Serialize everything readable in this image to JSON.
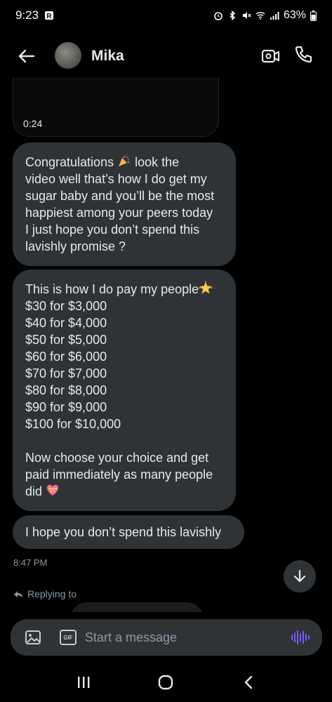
{
  "status_bar": {
    "time": "9:23",
    "battery": "63%"
  },
  "header": {
    "contact_name": "Mika"
  },
  "messages": {
    "video_duration": "0:24",
    "msg1": [
      "Congratulations",
      "video well that’s how I do get my",
      "sugar baby and you’ll be the most",
      "happiest among your peers today",
      "I just hope you don’t spend this",
      "lavishly promise ?"
    ],
    "msg1_line1_tail": "look the",
    "msg2_first": "This is how I do pay my people",
    "msg2": [
      "$30 for $3,000",
      "$40 for $4,000",
      "$50 for $5,000",
      "$60 for $6,000",
      "$70 for $7,000",
      "$80 for $8,000",
      "$90 for $9,000",
      "$100 for $10,000"
    ],
    "msg2_tail": [
      "Now choose your choice and get",
      "paid immediately as many people"
    ],
    "msg2_last": "did",
    "msg3": "I hope you don’t spend this lavishly",
    "timestamp": "8:47 PM"
  },
  "replying_to": "Replying to",
  "composer": {
    "placeholder": "Start a message",
    "gif_label": "GIF"
  },
  "colors": {
    "background": "#000000",
    "bubble": "#2f3336",
    "text": "#e7e9ea",
    "muted": "#8b98a5",
    "accent": "#7856ff"
  }
}
